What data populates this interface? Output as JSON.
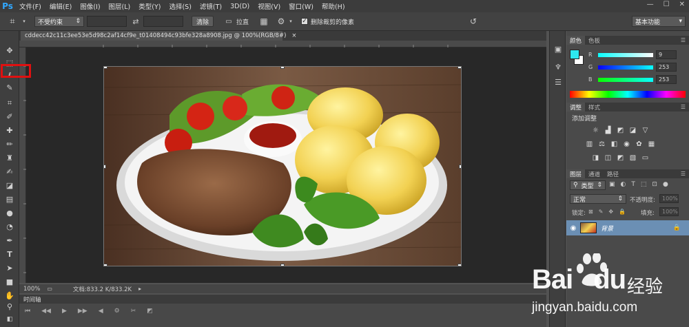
{
  "app": {
    "logo": "Ps"
  },
  "menu": [
    "文件(F)",
    "编辑(E)",
    "图像(I)",
    "图层(L)",
    "类型(Y)",
    "选择(S)",
    "滤镜(T)",
    "3D(D)",
    "视图(V)",
    "窗口(W)",
    "帮助(H)"
  ],
  "options": {
    "ratio": "不受约束",
    "clear": "清除",
    "straighten": "拉直",
    "delete_cropped": "删除裁剪的像素",
    "workspace": "基本功能"
  },
  "document": {
    "tab_title": "cddecc42c11c3ee53e5d98c2af14cf9e_t01408494c93bfe328a8908.jpg @ 100%(RGB/8#)",
    "close": "×"
  },
  "status": {
    "zoom": "100%",
    "doc_info": "文档:833.2 K/833.2K"
  },
  "timeline": {
    "label": "时间轴"
  },
  "panels": {
    "color_tabs": [
      "颜色",
      "色板"
    ],
    "color": {
      "fg": "#2ee8f0",
      "bg": "#ffffff",
      "r_label": "R",
      "r_value": "9",
      "g_label": "G",
      "g_value": "253",
      "b_label": "B",
      "b_value": "253"
    },
    "adjust_tabs": [
      "调整",
      "样式"
    ],
    "adjust_title": "添加调整",
    "layer_tabs": [
      "图层",
      "通道",
      "路径"
    ],
    "layers": {
      "filter": "类型",
      "blend_mode": "正常",
      "opacity_label": "不透明度:",
      "opacity_value": "100%",
      "lock_label": "锁定:",
      "fill_label": "填充:",
      "fill_value": "100%",
      "layer_name": "背景"
    }
  },
  "watermark": {
    "brand": "Bai",
    "brand2": "du",
    "cn": "经验",
    "url": "jingyan.baidu.com"
  }
}
